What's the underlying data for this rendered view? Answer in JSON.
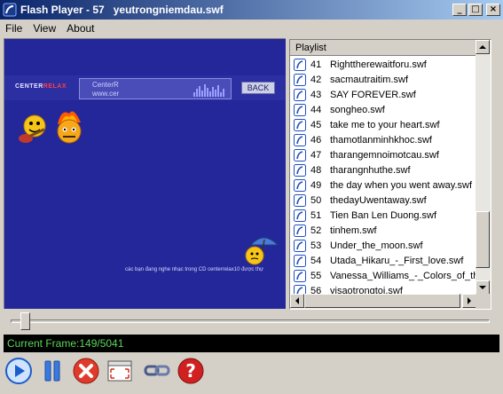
{
  "window": {
    "title": "Flash Player - 57   yeutrongniemdau.swf",
    "buttons": {
      "minimize": "_",
      "maximize": "□",
      "close": "×"
    }
  },
  "menu": [
    "File",
    "View",
    "About"
  ],
  "flash_stage": {
    "logo_prefix": "CENTER",
    "logo_suffix": "RELAX",
    "name_box_line1": "CenterR",
    "name_box_line2": "www.cer",
    "back_button": "BACK",
    "message": "các bạn đang nghe nhạc trong CD centerrelax10 được thự"
  },
  "playlist": {
    "header": "Playlist",
    "items": [
      {
        "num": "41",
        "name": "Righttherewaitforu.swf"
      },
      {
        "num": "42",
        "name": "sacmautraitim.swf"
      },
      {
        "num": "43",
        "name": "SAY FOREVER.swf"
      },
      {
        "num": "44",
        "name": "songheo.swf"
      },
      {
        "num": "45",
        "name": "take me to your heart.swf"
      },
      {
        "num": "46",
        "name": "thamotlanminhkhoc.swf"
      },
      {
        "num": "47",
        "name": "tharangemnoimotcau.swf"
      },
      {
        "num": "48",
        "name": "tharangnhuthe.swf"
      },
      {
        "num": "49",
        "name": "the day when you went away.swf"
      },
      {
        "num": "50",
        "name": "thedayUwentaway.swf"
      },
      {
        "num": "51",
        "name": "Tien Ban Len Duong.swf"
      },
      {
        "num": "52",
        "name": "tinhem.swf"
      },
      {
        "num": "53",
        "name": "Under_the_moon.swf"
      },
      {
        "num": "54",
        "name": "Utada_Hikaru_-_First_love.swf"
      },
      {
        "num": "55",
        "name": "Vanessa_Williams_-_Colors_of_the_"
      },
      {
        "num": "56",
        "name": "visaotrongtoi.swf"
      }
    ]
  },
  "status": {
    "current_frame": "Current Frame:149/5041"
  },
  "seek": {
    "position_fraction": 0.03
  },
  "toolbar": {
    "icons": [
      "play-icon",
      "pause-icon",
      "stop-icon",
      "fullscreen-icon",
      "link-icon",
      "help-icon"
    ]
  },
  "colors": {
    "titlebar_start": "#0a246a",
    "titlebar_end": "#a6caf0",
    "stage_bg": "#242799",
    "status_text": "#5ad85a",
    "face": "#d4d0c8"
  }
}
